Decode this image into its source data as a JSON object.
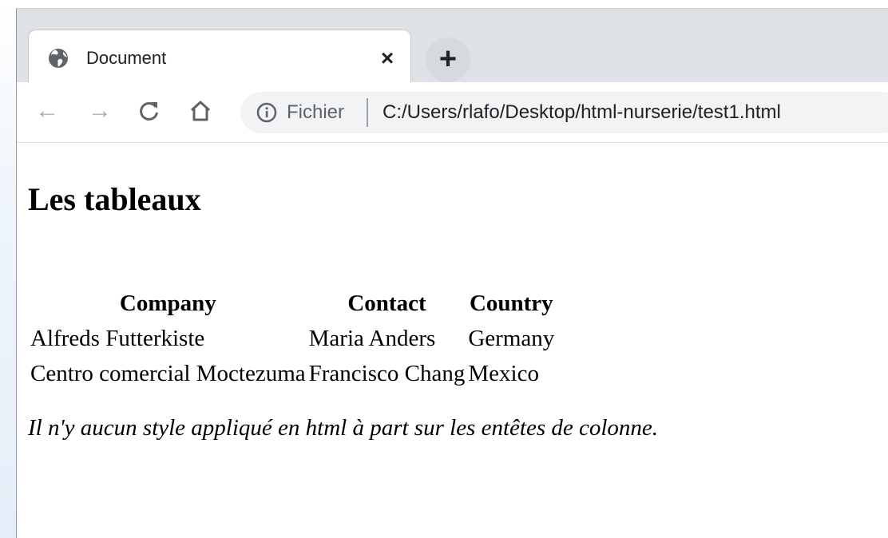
{
  "browser": {
    "tab": {
      "icon": "globe-icon",
      "title": "Document",
      "close_label": "×"
    },
    "new_tab_label": "+",
    "toolbar": {
      "back_icon": "arrow-left-icon",
      "back_glyph": "←",
      "forward_icon": "arrow-right-icon",
      "forward_glyph": "→",
      "reload_icon": "reload-icon",
      "reload_glyph": "C",
      "home_icon": "home-icon",
      "home_glyph": "⌂"
    },
    "omnibox": {
      "info_icon": "info-icon",
      "scheme_label": "Fichier",
      "url": "C:/Users/rlafo/Desktop/html-nurserie/test1.html"
    }
  },
  "page": {
    "heading": "Les tableaux",
    "table": {
      "headers": [
        "Company",
        "Contact",
        "Country"
      ],
      "rows": [
        [
          "Alfreds Futterkiste",
          "Maria Anders",
          "Germany"
        ],
        [
          "Centro comercial Moctezuma",
          "Francisco Chang",
          "Mexico"
        ]
      ]
    },
    "note": "Il n'y aucun style appliqué en html à part sur les entêtes de colonne."
  },
  "colors": {
    "tabstrip_bg": "#dee1e6",
    "omnibox_bg": "#f1f3f4",
    "text": "#202124",
    "muted": "#5f6368"
  }
}
